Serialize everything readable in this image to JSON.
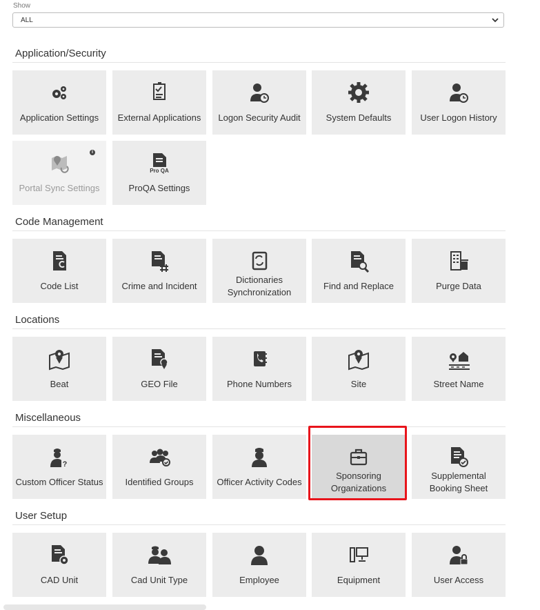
{
  "filter": {
    "label": "Show",
    "value": "ALL"
  },
  "sections": [
    {
      "title": "Application/Security",
      "tiles": [
        {
          "label": "Application Settings",
          "icon": "gears-icon"
        },
        {
          "label": "External Applications",
          "icon": "document-check-icon"
        },
        {
          "label": "Logon Security Audit",
          "icon": "user-clock-icon"
        },
        {
          "label": "System Defaults",
          "icon": "gear-icon"
        },
        {
          "label": "User Logon History",
          "icon": "user-clock-icon"
        },
        {
          "label": "Portal Sync Settings",
          "icon": "map-sync-icon",
          "disabled": true,
          "info": "i"
        },
        {
          "label": "ProQA Settings",
          "icon": "proqa-document-icon",
          "icon_text": "Pro QA"
        }
      ]
    },
    {
      "title": "Code Management",
      "tiles": [
        {
          "label": "Code List",
          "icon": "code-document-icon"
        },
        {
          "label": "Crime and Incident",
          "icon": "document-hash-icon"
        },
        {
          "label": "Dictionaries Synchronization",
          "icon": "book-sync-icon"
        },
        {
          "label": "Find and Replace",
          "icon": "document-search-icon"
        },
        {
          "label": "Purge Data",
          "icon": "building-trash-icon"
        }
      ]
    },
    {
      "title": "Locations",
      "tiles": [
        {
          "label": "Beat",
          "icon": "map-pin-icon"
        },
        {
          "label": "GEO File",
          "icon": "document-pin-icon"
        },
        {
          "label": "Phone Numbers",
          "icon": "phone-book-icon"
        },
        {
          "label": "Site",
          "icon": "map-pin-icon"
        },
        {
          "label": "Street Name",
          "icon": "street-house-icon"
        }
      ]
    },
    {
      "title": "Miscellaneous",
      "tiles": [
        {
          "label": "Custom Officer Status",
          "icon": "officer-question-icon"
        },
        {
          "label": "Identified Groups",
          "icon": "group-check-icon"
        },
        {
          "label": "Officer Activity Codes",
          "icon": "officer-icon"
        },
        {
          "label": "Sponsoring Organizations",
          "icon": "briefcase-icon",
          "selected": true
        },
        {
          "label": "Supplemental Booking Sheet",
          "icon": "document-check-circle-icon"
        }
      ]
    },
    {
      "title": "User Setup",
      "tiles": [
        {
          "label": "CAD Unit",
          "icon": "document-gear-icon"
        },
        {
          "label": "Cad Unit Type",
          "icon": "officers-icon"
        },
        {
          "label": "Employee",
          "icon": "user-icon"
        },
        {
          "label": "Equipment",
          "icon": "computer-icon"
        },
        {
          "label": "User Access",
          "icon": "user-lock-icon"
        }
      ]
    }
  ]
}
